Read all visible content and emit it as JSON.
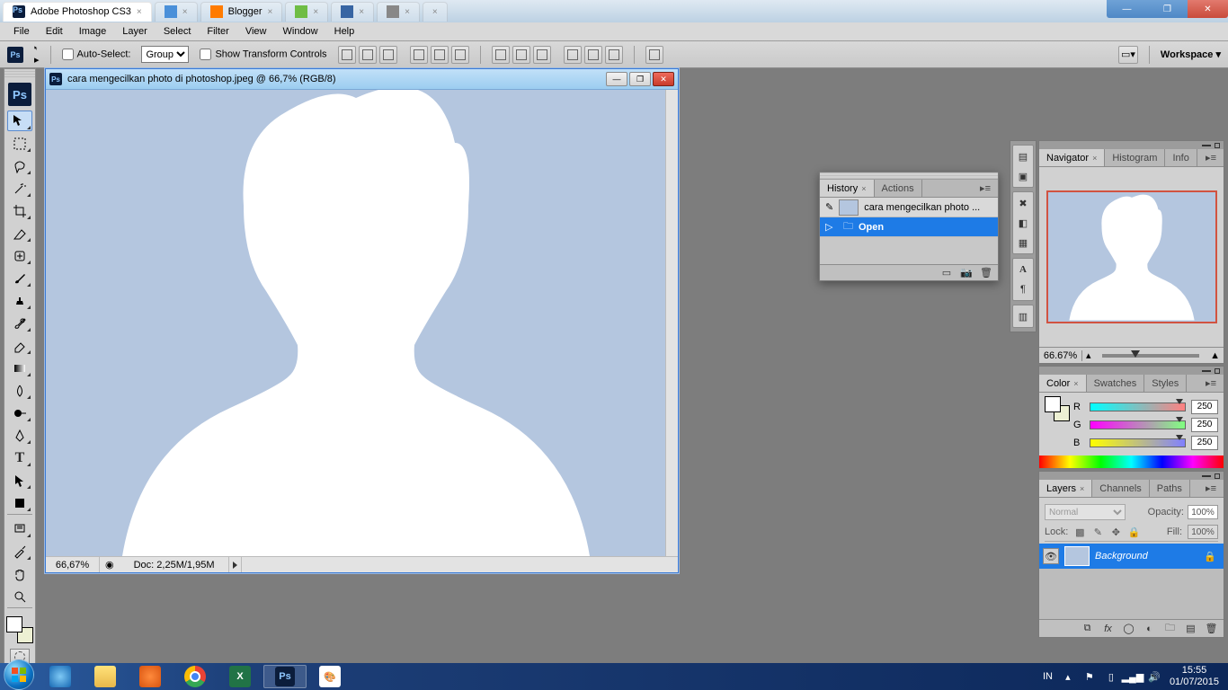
{
  "browser": {
    "tabs": [
      {
        "label": "Adobe Photoshop CS3",
        "active": true
      },
      {
        "label": "",
        "active": false
      },
      {
        "label": "Blogger",
        "active": false
      },
      {
        "label": "",
        "active": false
      },
      {
        "label": "",
        "active": false
      },
      {
        "label": "",
        "active": false
      },
      {
        "label": "",
        "active": false
      }
    ]
  },
  "titlebar": {
    "app": "Adobe Photoshop CS3"
  },
  "menubar": [
    "File",
    "Edit",
    "Image",
    "Layer",
    "Select",
    "Filter",
    "View",
    "Window",
    "Help"
  ],
  "options": {
    "auto_select": "Auto-Select:",
    "auto_select_value": "Group",
    "show_transform": "Show Transform Controls",
    "workspace": "Workspace ▾"
  },
  "document": {
    "title": "cara mengecilkan photo di photoshop.jpeg @ 66,7% (RGB/8)",
    "zoom": "66,67%",
    "info": "Doc: 2,25M/1,95M"
  },
  "history": {
    "tab1": "History",
    "tab2": "Actions",
    "snapshot": "cara mengecilkan photo ...",
    "step": "Open"
  },
  "navigator": {
    "tabs": [
      "Navigator",
      "Histogram",
      "Info"
    ],
    "zoom": "66.67%"
  },
  "color": {
    "tabs": [
      "Color",
      "Swatches",
      "Styles"
    ],
    "channels": [
      {
        "label": "R",
        "value": "250",
        "bg": "linear-gradient(to right,#00ffff,#ff0000)"
      },
      {
        "label": "G",
        "value": "250",
        "bg": "linear-gradient(to right,#ff00ff,#00ff00)"
      },
      {
        "label": "B",
        "value": "250",
        "bg": "linear-gradient(to right,#ffff00,#0000ff)"
      }
    ]
  },
  "layers": {
    "tabs": [
      "Layers",
      "Channels",
      "Paths"
    ],
    "blend": "Normal",
    "opacity_label": "Opacity:",
    "opacity": "100%",
    "lock_label": "Lock:",
    "fill_label": "Fill:",
    "fill": "100%",
    "layer_name": "Background"
  },
  "taskbar": {
    "lang": "IN",
    "time": "15:55",
    "date": "01/07/2015"
  }
}
